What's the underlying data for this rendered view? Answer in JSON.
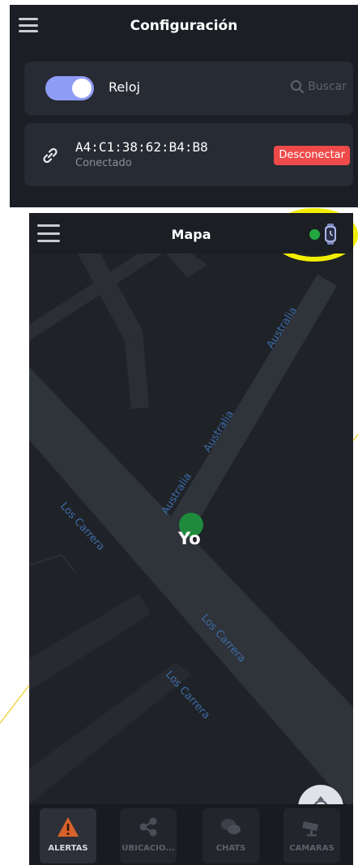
{
  "config_screen": {
    "title": "Configuración",
    "watch_toggle": {
      "label": "Reloj",
      "state": "on"
    },
    "search": {
      "label": "Buscar"
    },
    "device": {
      "mac": "A4:C1:38:62:B4:B8",
      "status": "Conectado",
      "disconnect_label": "Desconectar"
    }
  },
  "map_screen": {
    "title": "Mapa",
    "watch_connection": {
      "status_color": "#22a83f",
      "connected": true
    },
    "roads": [
      {
        "name": "Australia"
      },
      {
        "name": "Australia"
      },
      {
        "name": "Australia"
      },
      {
        "name": "Los Carrera"
      },
      {
        "name": "Los Carrera"
      },
      {
        "name": "Los Carrera"
      }
    ],
    "marker_label": "Yo",
    "marker_color": "#1f8a3c",
    "locate_icon": "crosshair-icon",
    "tabs": [
      {
        "label": "ALERTAS",
        "icon": "warning-icon",
        "active": true
      },
      {
        "label": "UBICACIO...",
        "icon": "share-icon",
        "active": false
      },
      {
        "label": "CHATS",
        "icon": "chat-icon",
        "active": false
      },
      {
        "label": "CAMARAS",
        "icon": "camera-icon",
        "active": false
      }
    ]
  },
  "colors": {
    "accent_toggle": "#8f9cf7",
    "danger": "#ef4a4a",
    "highlight_circle": "#f2ee00",
    "connector_line": "#f2d23a"
  }
}
